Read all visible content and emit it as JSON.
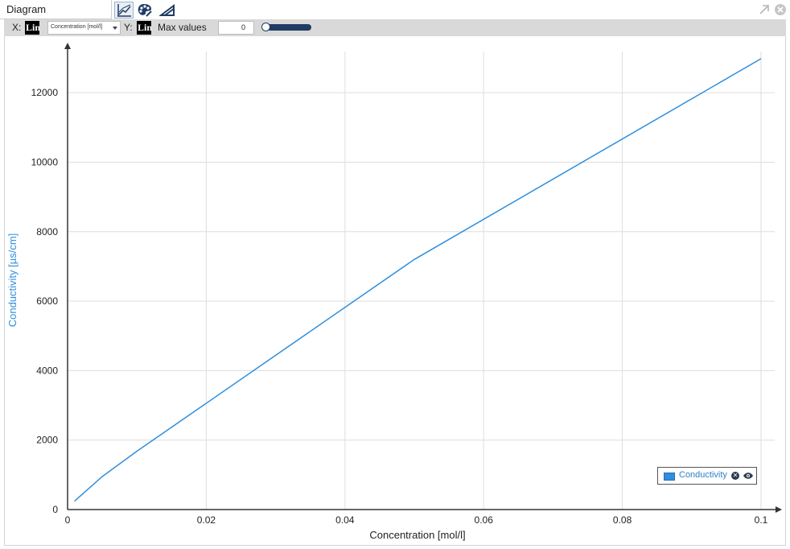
{
  "window": {
    "title": "Diagram",
    "toolbar_icons": [
      "line-chart-icon",
      "palette-icon",
      "ruler-icon"
    ],
    "window_icons": [
      "undock-icon",
      "close-icon"
    ]
  },
  "toolbar": {
    "x_label": "X:",
    "x_scale": "Lin",
    "x_select_value": "Concentration [mol/l]",
    "y_label": "Y:",
    "y_scale": "Lin",
    "max_values_label": "Max values",
    "max_values_value": "0",
    "max_values_slider": 0
  },
  "legend": {
    "label": "Conductivity",
    "color": "#2f8fde",
    "icons": [
      "remove-series-icon",
      "visibility-eye-icon"
    ]
  },
  "chart_data": {
    "type": "line",
    "title": "",
    "xlabel": "Concentration [mol/l]",
    "ylabel": "Conductivity [µs/cm]",
    "xlim": [
      0,
      0.1
    ],
    "ylim": [
      0,
      13000
    ],
    "x_ticks": [
      "0",
      "0.02",
      "0.04",
      "0.06",
      "0.08",
      "0.1"
    ],
    "y_ticks": [
      "0",
      "2000",
      "4000",
      "6000",
      "8000",
      "10000",
      "12000"
    ],
    "grid": true,
    "legend_position": "bottom-right",
    "series": [
      {
        "name": "Conductivity",
        "color": "#2f8fde",
        "x": [
          0.001,
          0.005,
          0.01,
          0.05,
          0.1
        ],
        "y": [
          240,
          950,
          1680,
          7200,
          12980
        ]
      }
    ]
  }
}
